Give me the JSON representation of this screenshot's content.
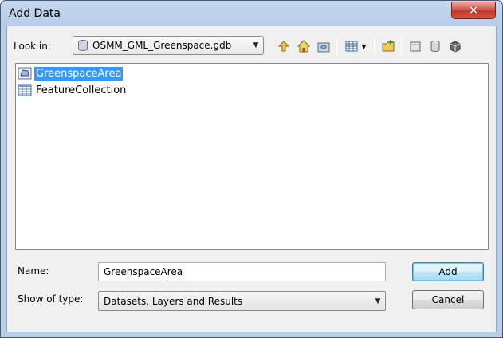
{
  "window": {
    "title": "Add Data"
  },
  "look_in": {
    "label": "Look in:",
    "value": "OSMM_GML_Greenspace.gdb"
  },
  "toolbar": {
    "icons": [
      "up-one-level-icon",
      "home-icon",
      "connect-folder-icon",
      "view-list-icon",
      "new-folder-icon",
      "new-geodatabase-icon",
      "new-toolbox-icon",
      "connect-database-icon"
    ]
  },
  "files": [
    {
      "name": "GreenspaceArea",
      "icon": "polygon-feature-class-icon",
      "selected": true
    },
    {
      "name": "FeatureCollection",
      "icon": "table-icon",
      "selected": false
    }
  ],
  "name_field": {
    "label": "Name:",
    "value": "GreenspaceArea"
  },
  "type_field": {
    "label": "Show of type:",
    "value": "Datasets, Layers and Results"
  },
  "buttons": {
    "add": "Add",
    "cancel": "Cancel"
  }
}
